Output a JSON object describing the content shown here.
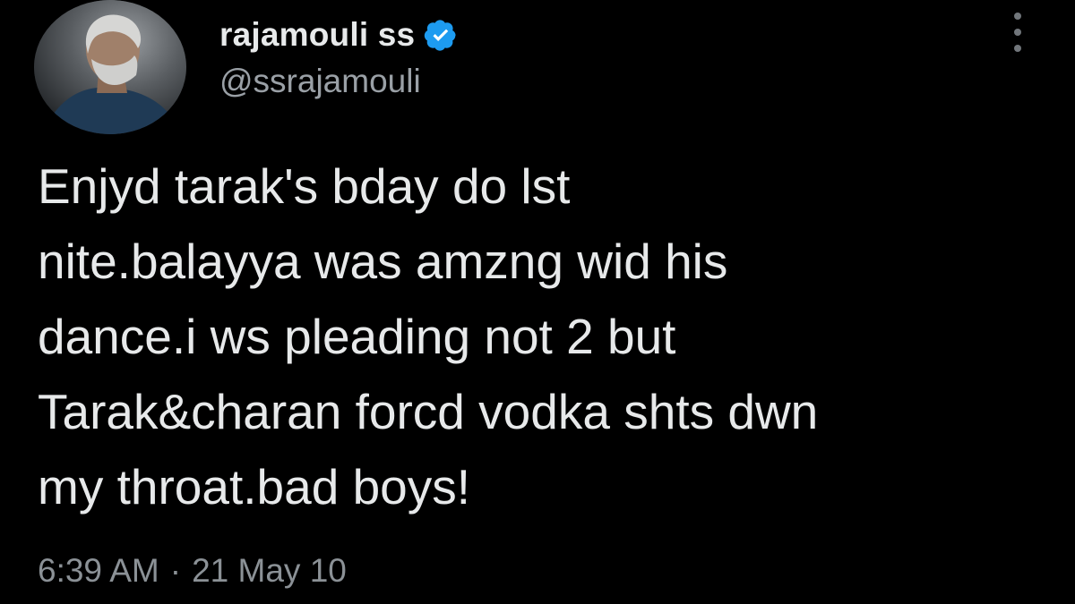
{
  "user": {
    "display_name": "rajamouli ss",
    "handle": "@ssrajamouli",
    "verified_icon": "verified-badge-icon",
    "avatar_icon": "profile-photo"
  },
  "tweet": {
    "lines": [
      "Enjyd tarak's bday do lst",
      "nite.balayya was amzng wid his",
      "dance.i ws pleading not 2 but",
      "Tarak&charan forcd vodka shts dwn",
      "my throat.bad boys!"
    ],
    "time": "6:39 AM",
    "separator": "·",
    "date": "21 May 10"
  },
  "colors": {
    "background": "#000000",
    "text": "#e7e9ea",
    "secondary": "#8b9196",
    "verified": "#1d9bf0"
  },
  "more_icon": "more-vertical-icon"
}
